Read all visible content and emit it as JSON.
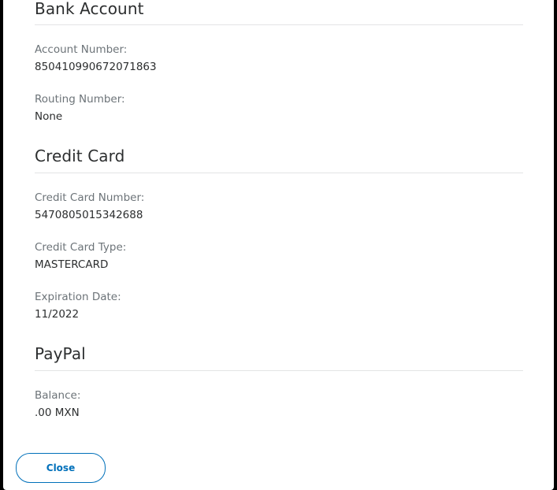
{
  "sections": {
    "bank_account": {
      "heading": "Bank Account",
      "account_number_label": "Account Number:",
      "account_number_value": "850410990672071863",
      "routing_number_label": "Routing Number:",
      "routing_number_value": "None"
    },
    "credit_card": {
      "heading": "Credit Card",
      "number_label": "Credit Card Number:",
      "number_value": "5470805015342688",
      "type_label": "Credit Card Type:",
      "type_value": "MASTERCARD",
      "expiration_label": "Expiration Date:",
      "expiration_value": "11/2022"
    },
    "paypal": {
      "heading": "PayPal",
      "balance_label": "Balance:",
      "balance_value": ".00 MXN"
    }
  },
  "footer": {
    "close_label": "Close"
  },
  "colors": {
    "accent": "#0070ba",
    "heading_text": "#2c2e2f",
    "label_text": "#6c7378",
    "divider": "#e3e4e5"
  }
}
